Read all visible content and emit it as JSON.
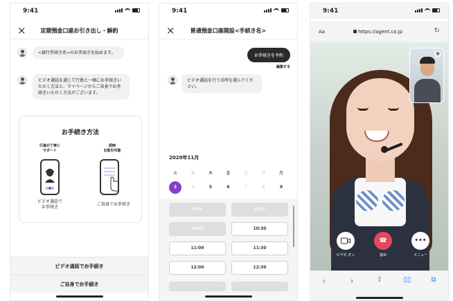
{
  "screens": {
    "consult": {
      "status_time": "9:41",
      "close_icon": "×",
      "title": "定期預金口座お引き出し・解約",
      "messages": [
        "<銀行手続き名>のお手続きを始めます。",
        "ビデオ通話を通じて行員と一緒にお手続きいただく方法と、マイページからご自身でお手続きいただく方法がございます。"
      ],
      "methods_card": {
        "heading": "お手続き方法",
        "ribbon_video": "行員が丁寧に\nサポート",
        "ribbon_self": "即時\nお取引可能",
        "label_video": "ビデオ通話で\nお手続き",
        "label_self": "ご自身でお手続き"
      },
      "buttons": {
        "video": "ビデオ通話でお手続き",
        "self": "ご自身でお手続き"
      }
    },
    "booking": {
      "status_time": "9:41",
      "close_icon": "×",
      "title": "普通預金口座開設<手続き名>",
      "user_message": "お手続きを予約",
      "edit_label": "編集する",
      "bot_message": "ビデオ通話を行う日時を選んでください。",
      "month": "2020年11月",
      "weekdays": [
        "火",
        "水",
        "木",
        "金",
        "土",
        "日",
        "月"
      ],
      "days": [
        "3",
        "4",
        "5",
        "6",
        "7",
        "8",
        "9"
      ],
      "selected_day_index": 0,
      "available_day_indexes": [
        2,
        3,
        6
      ],
      "time_slots": [
        {
          "left": "9:00",
          "right": "9:30",
          "left_available": false,
          "right_available": false
        },
        {
          "left": "10:00",
          "right": "10:30",
          "left_available": false,
          "right_available": true
        },
        {
          "left": "11:00",
          "right": "11:30",
          "left_available": true,
          "right_available": true
        },
        {
          "left": "12:00",
          "right": "12:30",
          "left_available": true,
          "right_available": true
        }
      ]
    },
    "video_call": {
      "status_time": "9:41",
      "aa_label": "Aa",
      "url": "https://agent.co.jp",
      "controls": [
        {
          "label": "ビデオ オン",
          "icon": "camera-icon"
        },
        {
          "label": "退出",
          "icon": "hang-up-icon"
        },
        {
          "label": "メニュー",
          "icon": "more-icon"
        }
      ],
      "toolbar_icons": [
        "back-icon",
        "forward-icon",
        "share-icon",
        "bookmarks-icon",
        "tabs-icon"
      ]
    }
  },
  "colors": {
    "accent_purple": "#8b3fc4",
    "hang_up_red": "#e24a5b",
    "link_blue": "#3478f6",
    "dark_pill": "#2a2a2a"
  }
}
